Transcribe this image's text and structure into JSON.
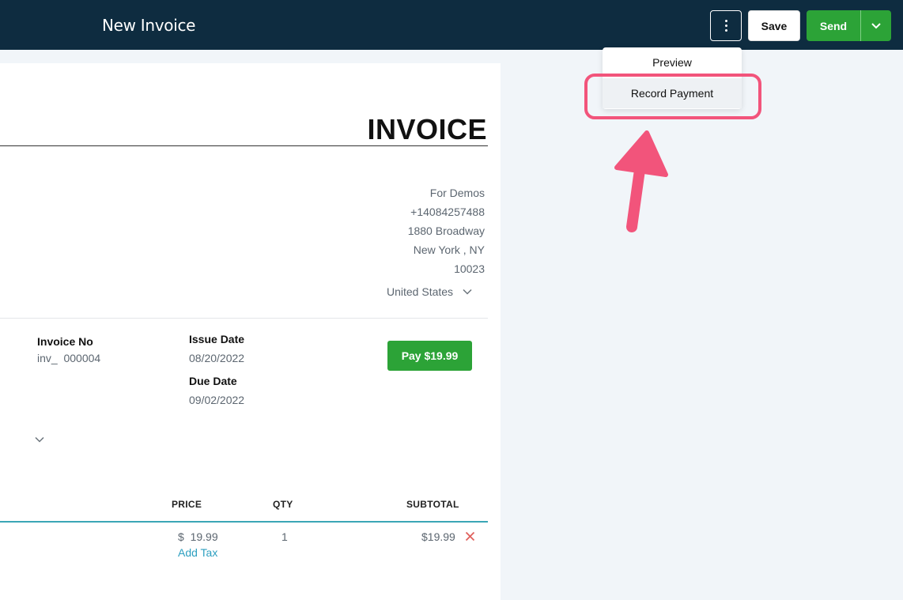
{
  "header": {
    "title": "New Invoice",
    "save_label": "Save",
    "send_label": "Send"
  },
  "menu": {
    "items": [
      {
        "label": "Preview"
      },
      {
        "label": "Record Payment"
      }
    ]
  },
  "invoice": {
    "heading": "INVOICE",
    "address": {
      "name": "For Demos",
      "phone": "+14084257488",
      "street": "1880 Broadway",
      "city": "New York",
      "state": "NY",
      "zip": "10023",
      "country": "United States"
    },
    "details": {
      "invoice_no_label": "Invoice No",
      "invoice_no_prefix": "inv_",
      "invoice_no_value": "000004",
      "issue_date_label": "Issue Date",
      "issue_date": "08/20/2022",
      "due_date_label": "Due Date",
      "due_date": "09/02/2022"
    },
    "pay_label": "Pay $19.99",
    "table": {
      "headers": {
        "price": "PRICE",
        "qty": "QTY",
        "subtotal": "SUBTOTAL"
      },
      "rows": [
        {
          "currency": "$",
          "price": "19.99",
          "add_tax": "Add Tax",
          "qty": "1",
          "subtotal": "$19.99"
        }
      ]
    }
  },
  "colors": {
    "header_bg": "#0e2c40",
    "accent_green": "#2ca337",
    "link_teal": "#2d9fc0",
    "annotation_pink": "#f2547b"
  },
  "icons": [
    "kebab-icon",
    "chevron-down-icon",
    "close-icon",
    "arrow-annotation"
  ]
}
